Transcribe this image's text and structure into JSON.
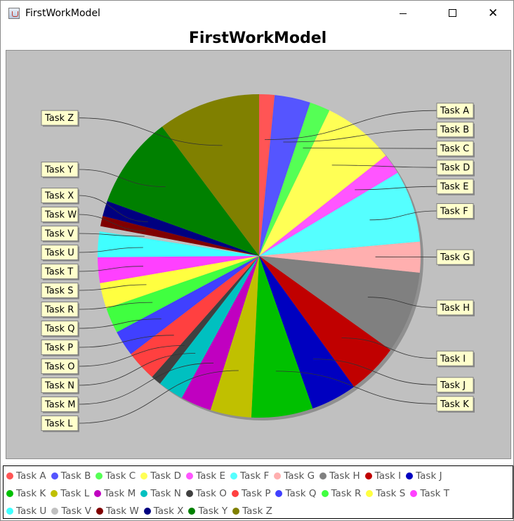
{
  "window": {
    "title": "FirstWorkModel",
    "minimize_icon": "minimize-icon",
    "maximize_icon": "maximize-icon",
    "close_icon": "close-icon",
    "close_glyph": "✕"
  },
  "chart_data": {
    "type": "pie",
    "title": "FirstWorkModel",
    "legend_placement": "bottom",
    "categories": [
      "Task A",
      "Task B",
      "Task C",
      "Task D",
      "Task E",
      "Task F",
      "Task G",
      "Task H",
      "Task I",
      "Task J",
      "Task K",
      "Task L",
      "Task M",
      "Task N",
      "Task O",
      "Task P",
      "Task Q",
      "Task R",
      "Task S",
      "Task T",
      "Task U",
      "Task V",
      "Task W",
      "Task X",
      "Task Y",
      "Task Z"
    ],
    "values": [
      1.5,
      3.5,
      2.0,
      7.0,
      2.0,
      7.0,
      3.0,
      8.0,
      5.0,
      4.5,
      6.0,
      4.0,
      3.0,
      2.5,
      1.0,
      3.0,
      2.5,
      2.5,
      2.5,
      2.5,
      2.5,
      0.5,
      1.0,
      1.5,
      9.0,
      10.0
    ],
    "colors": [
      "#ff5555",
      "#5555ff",
      "#55ff55",
      "#ffff55",
      "#ff55ff",
      "#55ffff",
      "#ffafaf",
      "#808080",
      "#c00000",
      "#0000c0",
      "#00c000",
      "#c0c000",
      "#c000c0",
      "#00c0c0",
      "#404040",
      "#ff4040",
      "#4040ff",
      "#40ff40",
      "#ffff40",
      "#ff40ff",
      "#40ffff",
      "#c0c0c0",
      "#800000",
      "#000080",
      "#008000",
      "#808000"
    ]
  }
}
